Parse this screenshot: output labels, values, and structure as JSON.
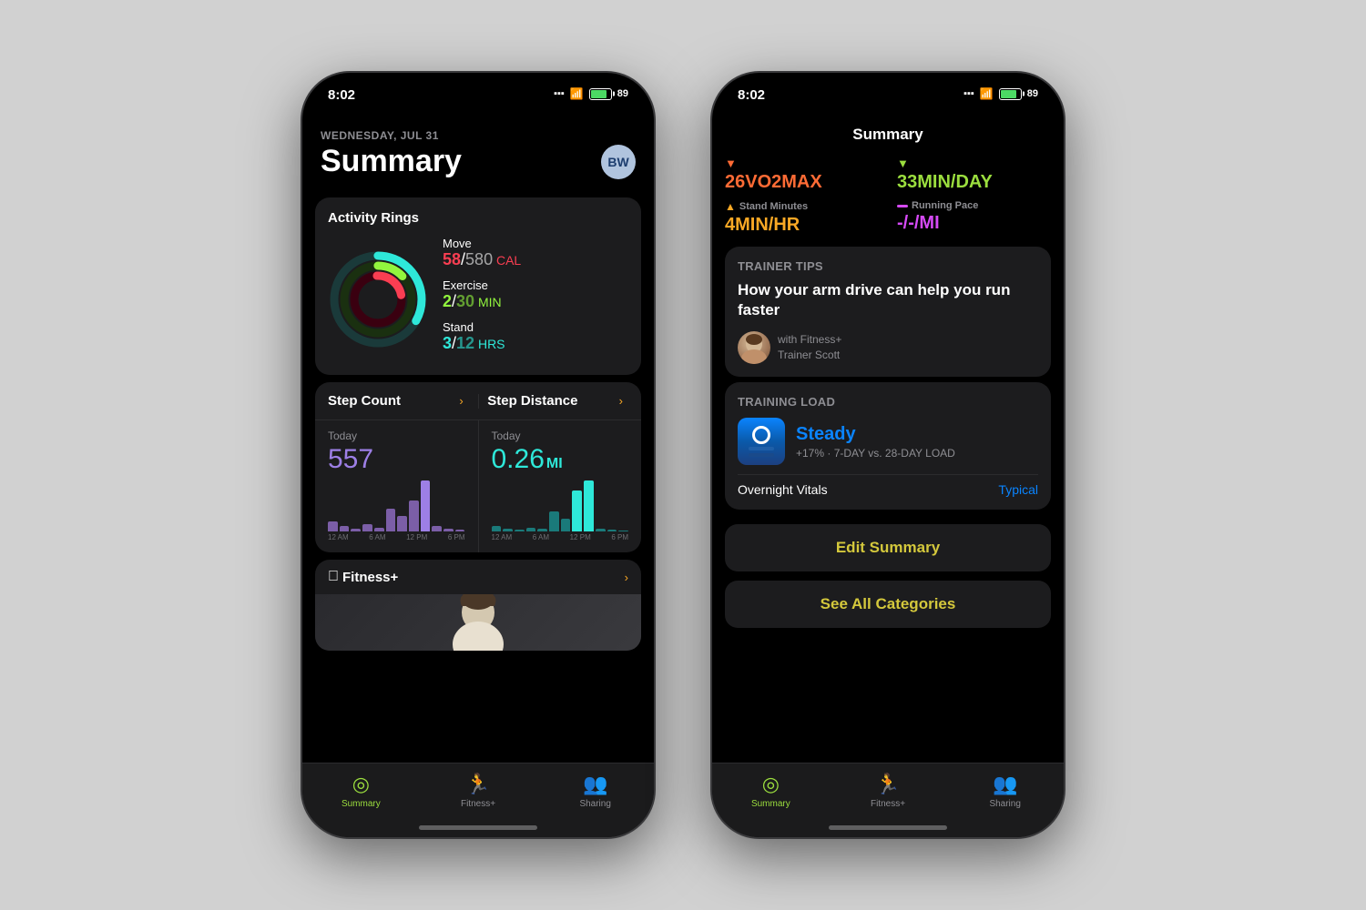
{
  "phone1": {
    "status": {
      "time": "8:02",
      "battery": "89"
    },
    "header": {
      "date": "WEDNESDAY, JUL 31",
      "title": "Summary",
      "avatar": "BW"
    },
    "activity_card": {
      "title": "Activity Rings",
      "move_label": "Move",
      "move_value": "58/580",
      "move_unit": "CAL",
      "exercise_label": "Exercise",
      "exercise_value": "2/30",
      "exercise_unit": "MIN",
      "stand_label": "Stand",
      "stand_value": "3/12",
      "stand_unit": "HRS"
    },
    "steps": {
      "step_count_label": "Step Count",
      "step_distance_label": "Step Distance",
      "today_label": "Today",
      "step_count_value": "557",
      "step_distance_value": "0.26",
      "step_distance_unit": "MI",
      "time_labels": [
        "12 AM",
        "6 AM",
        "12 PM",
        "6 PM"
      ]
    },
    "fitness": {
      "brand": "Fitness+",
      "arrow": "›"
    },
    "tabs": {
      "summary_label": "Summary",
      "fitness_label": "Fitness+",
      "sharing_label": "Sharing"
    }
  },
  "phone2": {
    "status": {
      "time": "8:02",
      "battery": "89"
    },
    "header": {
      "title": "Summary"
    },
    "metrics": {
      "vo2max_label": "26VO2MAX",
      "min_day_label": "33MIN/DAY",
      "stand_minutes_label": "Stand Minutes",
      "stand_minutes_value": "4MIN/HR",
      "running_pace_label": "Running Pace",
      "running_pace_value": "-/-/MI"
    },
    "trainer_tips": {
      "section_label": "Trainer Tips",
      "tip_text": "How your arm drive can help you run faster",
      "trainer_with": "with Fitness+",
      "trainer_name": "Trainer Scott"
    },
    "training_load": {
      "section_label": "Training Load",
      "status": "Steady",
      "detail": "+17% · 7-DAY vs. 28-DAY LOAD",
      "overnight_label": "Overnight Vitals",
      "overnight_value": "Typical"
    },
    "buttons": {
      "edit_summary": "Edit Summary",
      "see_all": "See All Categories"
    },
    "tabs": {
      "summary_label": "Summary",
      "fitness_label": "Fitness+",
      "sharing_label": "Sharing"
    }
  }
}
